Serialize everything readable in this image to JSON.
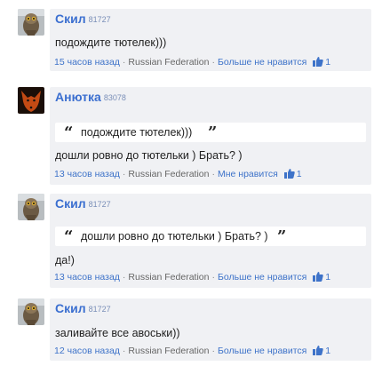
{
  "comments": [
    {
      "author": "Скил",
      "rating": "81727",
      "quote": "",
      "text": "подождите тютелек)))",
      "time": "15 часов назад",
      "country": "Russian Federation",
      "action": "Больше не нравится",
      "likes": "1",
      "avatar": "owl-avatar"
    },
    {
      "author": "Анютка",
      "rating": "83078",
      "quote": "подождите тютелек)))",
      "text": "дошли ровно до тютельки ) Брать? )",
      "time": "13 часов назад",
      "country": "Russian Federation",
      "action": "Мне нравится",
      "likes": "1",
      "avatar": "fox-avatar"
    },
    {
      "author": "Скил",
      "rating": "81727",
      "quote": "дошли ровно до тютельки ) Брать? )",
      "text": "да!)",
      "time": "13 часов назад",
      "country": "Russian Federation",
      "action": "Больше не нравится",
      "likes": "1",
      "avatar": "owl-avatar"
    },
    {
      "author": "Скил",
      "rating": "81727",
      "quote": "",
      "text": "заливайте все авоськи))",
      "time": "12 часов назад",
      "country": "Russian Federation",
      "action": "Больше не нравится",
      "likes": "1",
      "avatar": "owl-avatar"
    }
  ],
  "quote_open": "“",
  "quote_close": "”",
  "colors": {
    "link": "#3e73c9",
    "bubble": "#f0f1f4"
  }
}
